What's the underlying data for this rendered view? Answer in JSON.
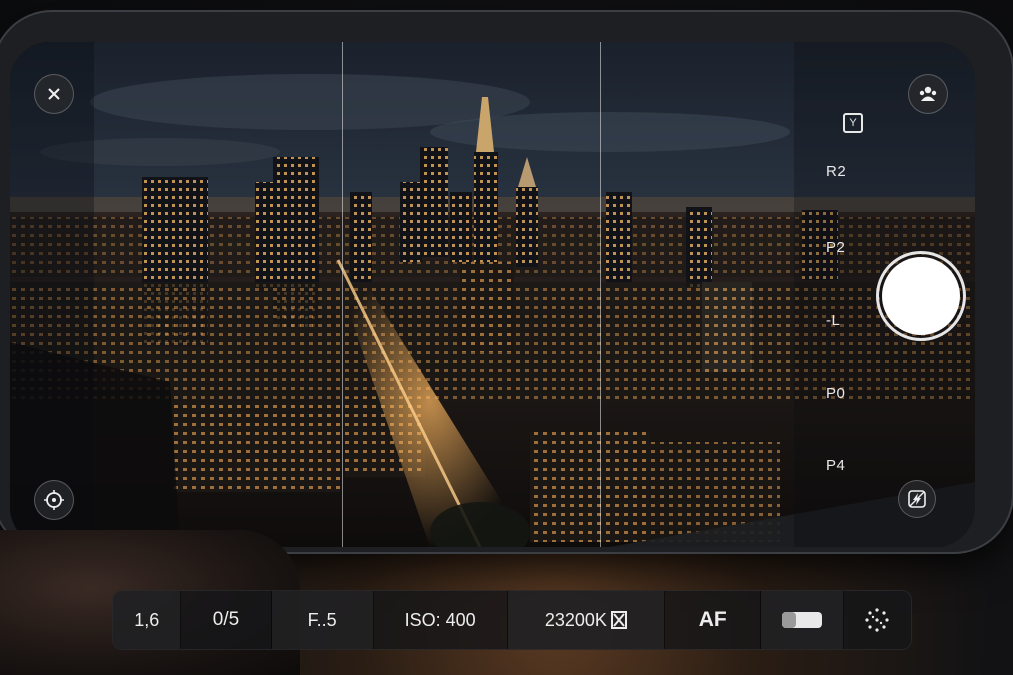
{
  "app": {
    "name": "Camera viewfinder"
  },
  "viewfinder": {
    "scene": "night city skyline"
  },
  "left_controls": {
    "close_icon": "close-icon",
    "focus_icon": "focus-target-icon"
  },
  "right_controls": {
    "aspect_icon": "aspect-ratio-icon",
    "aspect_glyph": "Y",
    "portrait_icon": "people-icon",
    "presets": [
      "R2",
      "P2",
      "-L",
      "P0",
      "P4"
    ],
    "flash_icon": "flash-off-icon"
  },
  "bottom_bar": {
    "shutter_speed": "1,6",
    "exposure": "0/5",
    "aperture": "F..5",
    "iso": "ISO: 400",
    "white_balance": "23200K",
    "wb_icon": "white-balance-icon",
    "focus_mode": "AF",
    "toggle_icon": "toggle-icon",
    "grid_icon": "dotted-grid-icon"
  },
  "colors": {
    "accent": "#ffffff",
    "bar_bg": "#161618",
    "text": "#ededed"
  }
}
